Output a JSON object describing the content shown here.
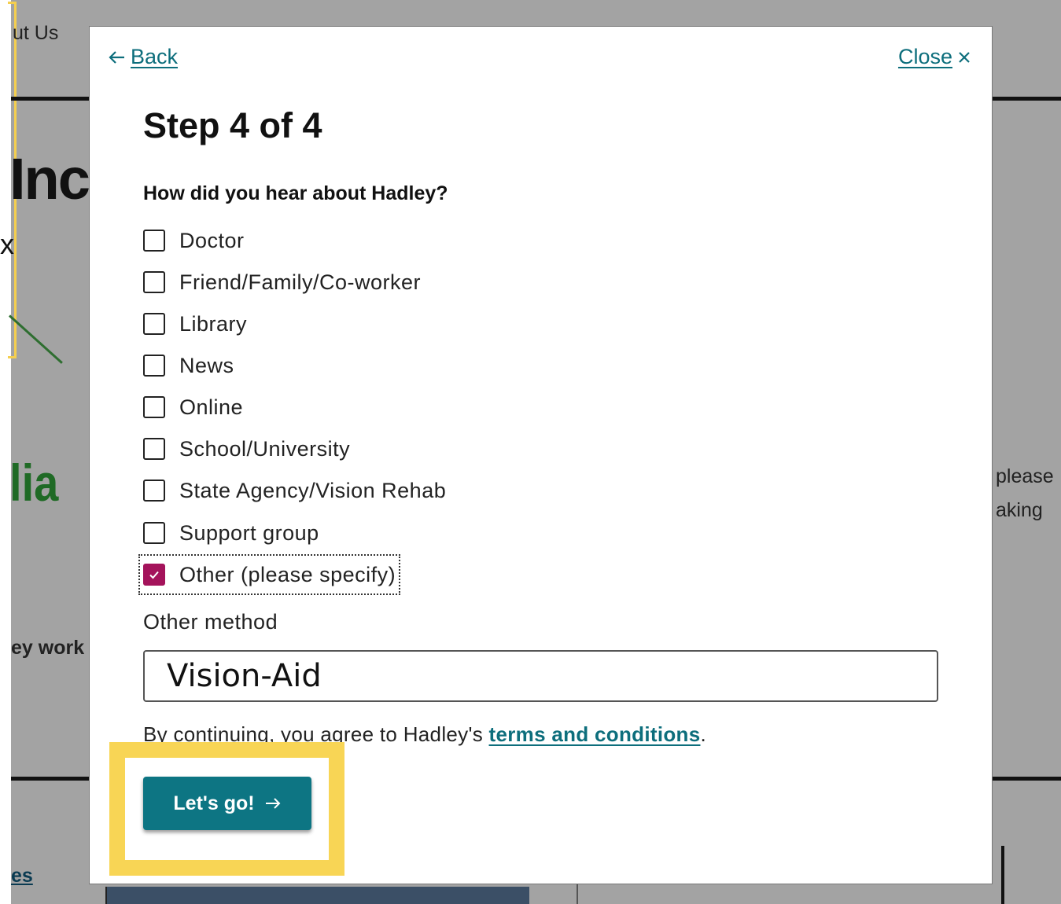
{
  "background": {
    "nav_fragment": "ut Us",
    "heading_fragment": "Inc",
    "x_fragment": "x",
    "green_fragment": "lia",
    "text_fragment_1": "ey work",
    "right_fragment_1": "please",
    "right_fragment_2": "aking",
    "link_fragment": "es"
  },
  "modal": {
    "back_label": "Back",
    "close_label": "Close",
    "step_title": "Step 4 of 4",
    "question": "How did you hear about Hadley?",
    "options": [
      {
        "label": "Doctor",
        "checked": false
      },
      {
        "label": "Friend/Family/Co-worker",
        "checked": false
      },
      {
        "label": "Library",
        "checked": false
      },
      {
        "label": "News",
        "checked": false
      },
      {
        "label": "Online",
        "checked": false
      },
      {
        "label": "School/University",
        "checked": false
      },
      {
        "label": "State Agency/Vision Rehab",
        "checked": false
      },
      {
        "label": "Support group",
        "checked": false
      },
      {
        "label": "Other (please specify)",
        "checked": true
      }
    ],
    "other_label": "Other method",
    "other_value": "Vision-Aid",
    "terms_prefix": "By continuing, you agree to Hadley's ",
    "terms_link": "terms and conditions",
    "terms_suffix": ".",
    "submit_label": "Let's go!"
  },
  "colors": {
    "accent": "#0d7583",
    "checkbox_checked": "#a4135b",
    "highlight": "#f8d555",
    "overlay": "#a3a3a3"
  }
}
